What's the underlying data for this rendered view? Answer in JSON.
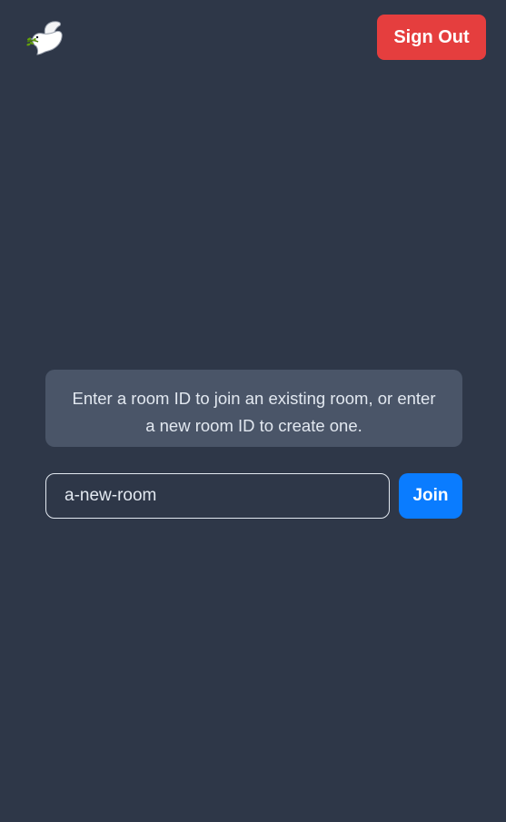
{
  "header": {
    "logo_icon": "dove-with-olive-branch-icon",
    "sign_out_label": "Sign Out"
  },
  "main": {
    "info_text": "Enter a room ID to join an existing room, or enter a new room ID to create one.",
    "room_input_value": "a-new-room",
    "join_label": "Join"
  },
  "colors": {
    "background": "#2e3748",
    "sign_out": "#e53e3e",
    "join": "#0a7cff",
    "info_box": "#4a5568"
  }
}
